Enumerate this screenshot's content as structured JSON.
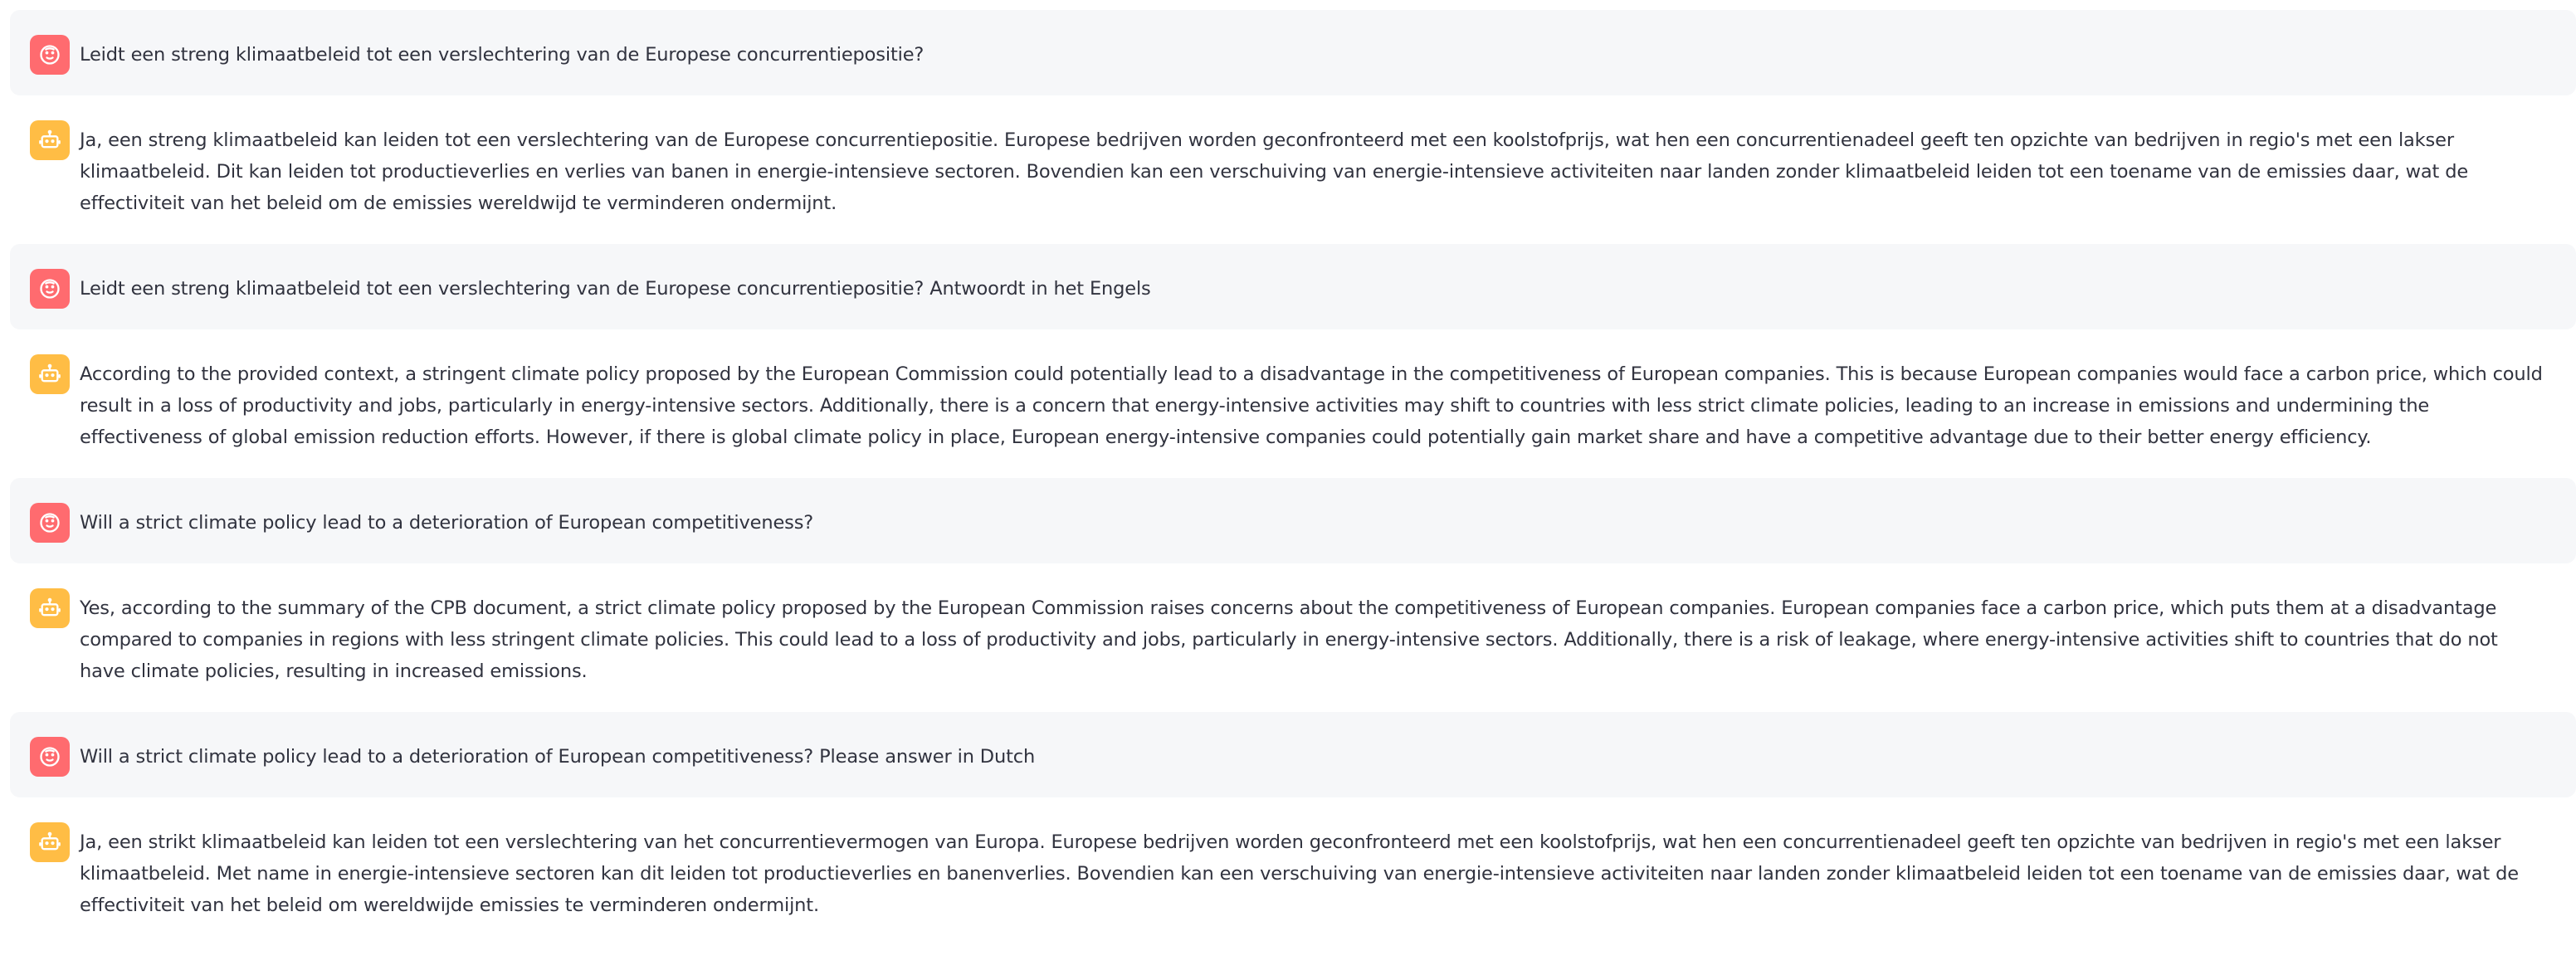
{
  "chat": {
    "messages": [
      {
        "role": "user",
        "avatar_icon": "user-face-icon",
        "text": "Leidt een streng klimaatbeleid tot een verslechtering van de Europese concurrentiepositie?"
      },
      {
        "role": "assistant",
        "avatar_icon": "robot-icon",
        "text": "Ja, een streng klimaatbeleid kan leiden tot een verslechtering van de Europese concurrentiepositie. Europese bedrijven worden geconfronteerd met een koolstofprijs, wat hen een concurrentienadeel geeft ten opzichte van bedrijven in regio's met een lakser klimaatbeleid. Dit kan leiden tot productieverlies en verlies van banen in energie-intensieve sectoren. Bovendien kan een verschuiving van energie-intensieve activiteiten naar landen zonder klimaatbeleid leiden tot een toename van de emissies daar, wat de effectiviteit van het beleid om de emissies wereldwijd te verminderen ondermijnt."
      },
      {
        "role": "user",
        "avatar_icon": "user-face-icon",
        "text": "Leidt een streng klimaatbeleid tot een verslechtering van de Europese concurrentiepositie? Antwoordt in het Engels"
      },
      {
        "role": "assistant",
        "avatar_icon": "robot-icon",
        "text": "According to the provided context, a stringent climate policy proposed by the European Commission could potentially lead to a disadvantage in the competitiveness of European companies. This is because European companies would face a carbon price, which could result in a loss of productivity and jobs, particularly in energy-intensive sectors. Additionally, there is a concern that energy-intensive activities may shift to countries with less strict climate policies, leading to an increase in emissions and undermining the effectiveness of global emission reduction efforts. However, if there is global climate policy in place, European energy-intensive companies could potentially gain market share and have a competitive advantage due to their better energy efficiency."
      },
      {
        "role": "user",
        "avatar_icon": "user-face-icon",
        "text": "Will a strict climate policy lead to a deterioration of European competitiveness?"
      },
      {
        "role": "assistant",
        "avatar_icon": "robot-icon",
        "text": "Yes, according to the summary of the CPB document, a strict climate policy proposed by the European Commission raises concerns about the competitiveness of European companies. European companies face a carbon price, which puts them at a disadvantage compared to companies in regions with less stringent climate policies. This could lead to a loss of productivity and jobs, particularly in energy-intensive sectors. Additionally, there is a risk of leakage, where energy-intensive activities shift to countries that do not have climate policies, resulting in increased emissions."
      },
      {
        "role": "user",
        "avatar_icon": "user-face-icon",
        "text": "Will a strict climate policy lead to a deterioration of European competitiveness? Please answer in Dutch"
      },
      {
        "role": "assistant",
        "avatar_icon": "robot-icon",
        "text": "Ja, een strikt klimaatbeleid kan leiden tot een verslechtering van het concurrentievermogen van Europa. Europese bedrijven worden geconfronteerd met een koolstofprijs, wat hen een concurrentienadeel geeft ten opzichte van bedrijven in regio's met een lakser klimaatbeleid. Met name in energie-intensieve sectoren kan dit leiden tot productieverlies en banenverlies. Bovendien kan een verschuiving van energie-intensieve activiteiten naar landen zonder klimaatbeleid leiden tot een toename van de emissies daar, wat de effectiviteit van het beleid om wereldwijde emissies te verminderen ondermijnt."
      }
    ]
  },
  "colors": {
    "user_avatar": "#ff6b6f",
    "assistant_avatar": "#ffbd45",
    "user_bubble": "#f6f7f9",
    "text": "#31333f"
  }
}
